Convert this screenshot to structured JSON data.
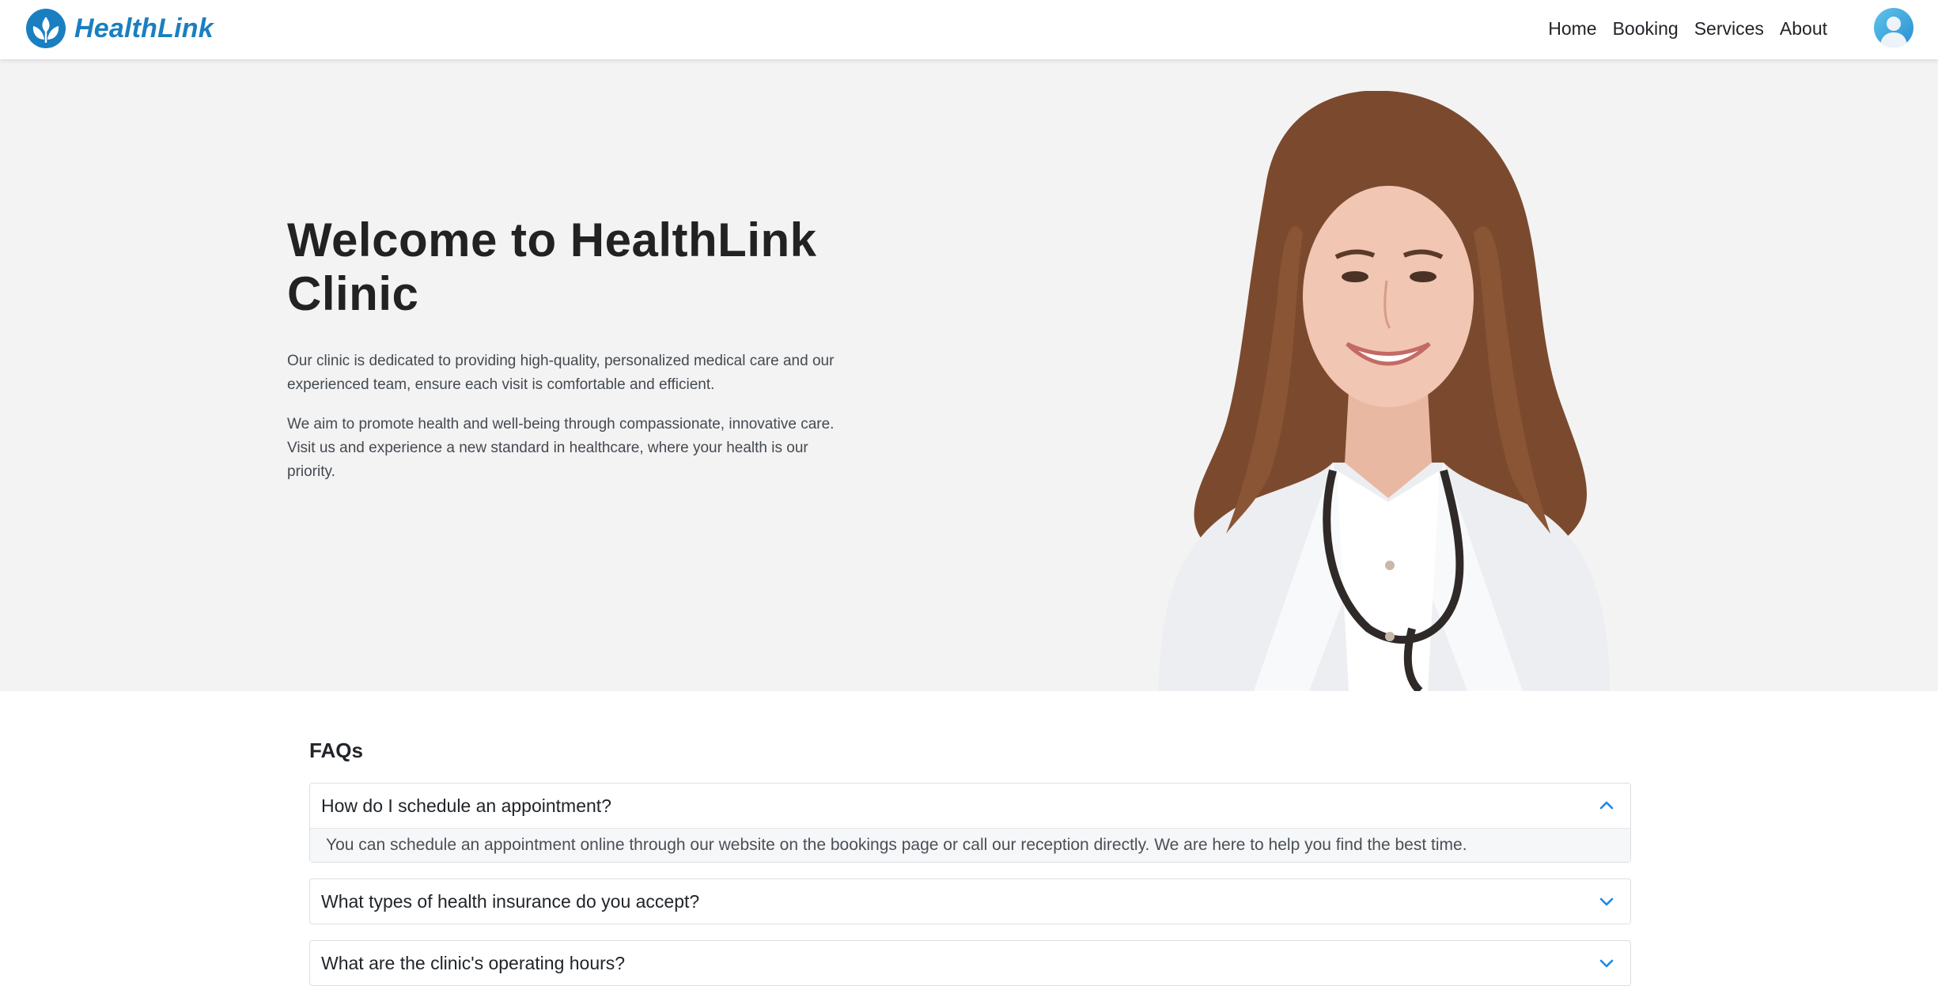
{
  "brand": {
    "name": "HealthLink",
    "color": "#1a7fc1",
    "logo_icon": "leaf-circle-icon"
  },
  "nav": {
    "links": [
      {
        "label": "Home"
      },
      {
        "label": "Booking"
      },
      {
        "label": "Services"
      },
      {
        "label": "About"
      }
    ],
    "avatar_icon": "user-avatar-icon"
  },
  "hero": {
    "title": "Welcome to HealthLink Clinic",
    "paragraphs": [
      "Our clinic is dedicated to providing high-quality, personalized medical care and our experienced team, ensure each visit is comfortable and efficient.",
      "We aim to promote health and well-being through compassionate, innovative care. Visit us and experience a new standard in healthcare, where your health is our priority."
    ],
    "image": "doctor-photo"
  },
  "faq": {
    "title": "FAQs",
    "items": [
      {
        "question": "How do I schedule an appointment?",
        "answer": "You can schedule an appointment online through our website on the bookings page or call our reception directly. We are here to help you find the best time.",
        "expanded": true,
        "icon": "chevron-up-icon"
      },
      {
        "question": "What types of health insurance do you accept?",
        "expanded": false,
        "icon": "chevron-down-icon"
      },
      {
        "question": "What are the clinic's operating hours?",
        "expanded": false,
        "icon": "chevron-down-icon"
      }
    ]
  },
  "colors": {
    "accent": "#1a7fc1",
    "hero_bg": "#f3f3f4",
    "chevron": "#1e88e5"
  }
}
